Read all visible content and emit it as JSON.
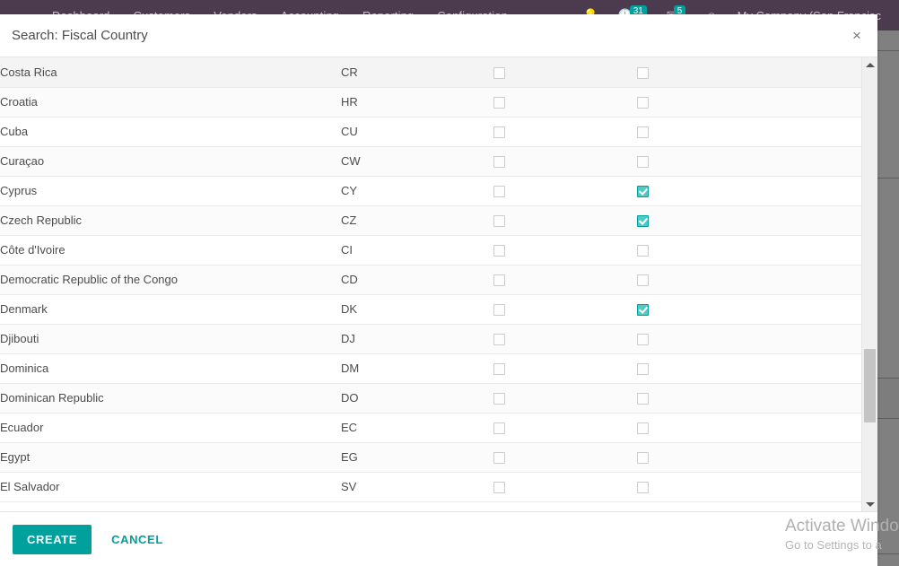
{
  "navbar": {
    "menu_items": [
      {
        "label": "Dashboard"
      },
      {
        "label": "Customers"
      },
      {
        "label": "Vendors"
      },
      {
        "label": "Accounting"
      },
      {
        "label": "Reporting"
      },
      {
        "label": "Configuration"
      }
    ],
    "activity_badge": "31",
    "messages_badge": "5",
    "company": "My Company (San Francisc",
    "background_color": "#4c3b4e",
    "badge_color": "#00a09d"
  },
  "dialog": {
    "title": "Search: Fiscal Country",
    "close_label": "×",
    "footer": {
      "create_label": "CREATE",
      "cancel_label": "CANCEL",
      "accent_color": "#00a09d"
    }
  },
  "table": {
    "rows": [
      {
        "name": "Costa Rica",
        "code": "CR",
        "check1": false,
        "check2": false,
        "hover": true
      },
      {
        "name": "Croatia",
        "code": "HR",
        "check1": false,
        "check2": false,
        "hover": false
      },
      {
        "name": "Cuba",
        "code": "CU",
        "check1": false,
        "check2": false,
        "hover": false
      },
      {
        "name": "Curaçao",
        "code": "CW",
        "check1": false,
        "check2": false,
        "hover": false
      },
      {
        "name": "Cyprus",
        "code": "CY",
        "check1": false,
        "check2": true,
        "hover": false
      },
      {
        "name": "Czech Republic",
        "code": "CZ",
        "check1": false,
        "check2": true,
        "hover": false
      },
      {
        "name": "Côte d'Ivoire",
        "code": "CI",
        "check1": false,
        "check2": false,
        "hover": false
      },
      {
        "name": "Democratic Republic of the Congo",
        "code": "CD",
        "check1": false,
        "check2": false,
        "hover": false
      },
      {
        "name": "Denmark",
        "code": "DK",
        "check1": false,
        "check2": true,
        "hover": false
      },
      {
        "name": "Djibouti",
        "code": "DJ",
        "check1": false,
        "check2": false,
        "hover": false
      },
      {
        "name": "Dominica",
        "code": "DM",
        "check1": false,
        "check2": false,
        "hover": false
      },
      {
        "name": "Dominican Republic",
        "code": "DO",
        "check1": false,
        "check2": false,
        "hover": false
      },
      {
        "name": "Ecuador",
        "code": "EC",
        "check1": false,
        "check2": false,
        "hover": false
      },
      {
        "name": "Egypt",
        "code": "EG",
        "check1": false,
        "check2": false,
        "hover": false
      },
      {
        "name": "El Salvador",
        "code": "SV",
        "check1": false,
        "check2": false,
        "hover": false
      }
    ]
  },
  "scrollbar": {
    "up_arrow": "scroll-up",
    "down_arrow": "scroll-down"
  },
  "watermark": {
    "title": "Activate Windows",
    "subtitle": "Go to Settings to a"
  }
}
